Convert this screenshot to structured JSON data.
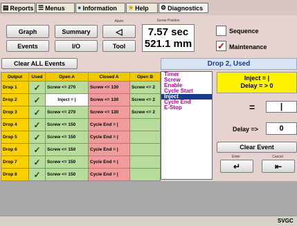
{
  "tabs": [
    {
      "label": "Reports",
      "icon": "report-icon"
    },
    {
      "label": "Menus",
      "icon": "menu-icon"
    },
    {
      "label": "Information",
      "icon": "info-icon"
    },
    {
      "label": "Help",
      "icon": "help-icon"
    },
    {
      "label": "Diagnostics",
      "icon": "diagnostics-icon"
    }
  ],
  "buttons": {
    "graph": "Graph",
    "summary": "Summary",
    "events": "Events",
    "io": "I/O",
    "tool": "Tool",
    "clear_all": "Clear ALL Events",
    "clear_event": "Clear Event"
  },
  "alarm": {
    "label": "Alarm",
    "icon": "speaker-icon"
  },
  "screw": {
    "label": "Screw Position",
    "time": "7.57 sec",
    "position": "521.1 mm"
  },
  "options": {
    "sequence": "Sequence",
    "maintenance": "Maintenance",
    "sequence_checked": false,
    "maintenance_checked": true
  },
  "panel": {
    "title": "Drop 2, Used",
    "condition_line1": "Inject = |",
    "condition_line2": "Delay = > 0",
    "equals": "=",
    "pipe_value": "|",
    "delay_label": "Delay =>",
    "delay_value": "0",
    "enter_label": "Enter",
    "cancel_label": "Cancel"
  },
  "event_list": [
    "Timer",
    "Screw",
    "Enable",
    "Cycle Start",
    "Inject",
    "Cycle End",
    "E-Stop"
  ],
  "table": {
    "headers": [
      "Output",
      "Used",
      "Open A",
      "Closed A",
      "Open B"
    ],
    "rows": [
      {
        "output": "Drop 1",
        "used": "✓",
        "open_a": "Screw <= 270",
        "closed_a": "Screw <= 130",
        "open_b": "Screw <= 2"
      },
      {
        "output": "Drop 2",
        "used": "✓",
        "open_a": "Inject = |",
        "closed_a": "Screw <= 130",
        "open_b": "Screw <= 2"
      },
      {
        "output": "Drop 3",
        "used": "✓",
        "open_a": "Screw <= 270",
        "closed_a": "Screw <= 130",
        "open_b": "Screw <= 2"
      },
      {
        "output": "Drop 4",
        "used": "✓",
        "open_a": "Screw <= 150",
        "closed_a": "Cycle End = |",
        "open_b": ""
      },
      {
        "output": "Drop 5",
        "used": "✓",
        "open_a": "Screw <= 150",
        "closed_a": "Cycle End = |",
        "open_b": ""
      },
      {
        "output": "Drop 6",
        "used": "✓",
        "open_a": "Screw <= 150",
        "closed_a": "Cycle End = |",
        "open_b": ""
      },
      {
        "output": "Drop 7",
        "used": "✓",
        "open_a": "Screw <= 150",
        "closed_a": "Cycle End = |",
        "open_b": ""
      },
      {
        "output": "Drop 8",
        "used": "✓",
        "open_a": "Screw <= 150",
        "closed_a": "Cycle End = |",
        "open_b": ""
      }
    ]
  },
  "status": {
    "text": "SVGC"
  }
}
